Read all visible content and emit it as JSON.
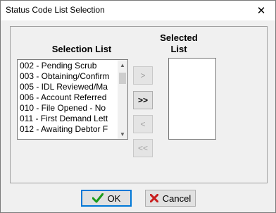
{
  "window": {
    "title": "Status Code List Selection",
    "close_glyph": "✕"
  },
  "selection_list": {
    "label": "Selection List",
    "items": [
      "002 - Pending Scrub",
      "003 - Obtaining/Confirm",
      "005 - IDL Reviewed/Ma",
      "006 - Account Referred",
      "010 - File Opened - No",
      "011 - First Demand Lett",
      "012 - Awaiting Debtor F"
    ]
  },
  "selected_list": {
    "label_line1": "Selected",
    "label_line2": "List"
  },
  "move_buttons": {
    "add_one": ">",
    "add_all": ">>",
    "remove_one": "<",
    "remove_all": "<<"
  },
  "buttons": {
    "ok": "OK",
    "cancel": "Cancel"
  },
  "colors": {
    "ok_check": "#1a9a1a",
    "cancel_x": "#c81e1e",
    "focus_border": "#0078d7"
  }
}
